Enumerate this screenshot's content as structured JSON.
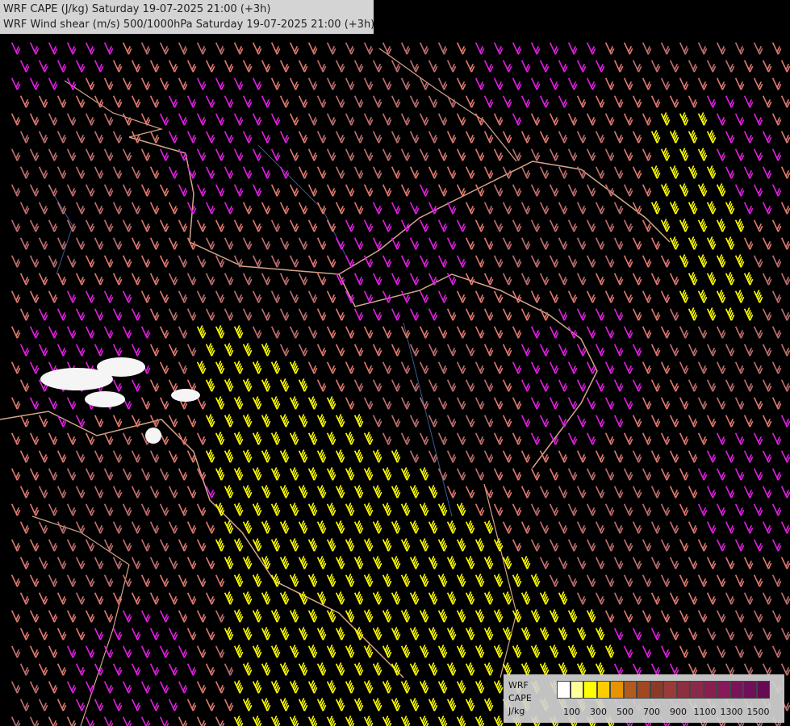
{
  "title": {
    "line1": "WRF CAPE (J/kg) Saturday 19-07-2025 21:00 (+3h)",
    "line2": "WRF Wind shear (m/s) 500/1000hPa Saturday 19-07-2025 21:00 (+3h)"
  },
  "legend": {
    "label1": "WRF",
    "label2": "CAPE",
    "label3": "J/kg",
    "ticks": [
      "100",
      "300",
      "500",
      "700",
      "900",
      "1100",
      "1300",
      "1500"
    ],
    "colors": [
      "#ffffff",
      "#ffff99",
      "#ffff00",
      "#ffcc00",
      "#e69500",
      "#b35a1f",
      "#a0481f",
      "#8b3a2a",
      "#9a3b3b",
      "#8c2f3f",
      "#8a2a4a",
      "#8a1f4f",
      "#861a5a",
      "#7a145a",
      "#700f5a",
      "#660a55"
    ]
  },
  "barb_colors": {
    "magenta": "#e020e0",
    "salmon": "#e07a70",
    "rose": "#c07070",
    "yellow": "#ffff00",
    "border": "#d4a38a",
    "river": "#3a5a90"
  }
}
